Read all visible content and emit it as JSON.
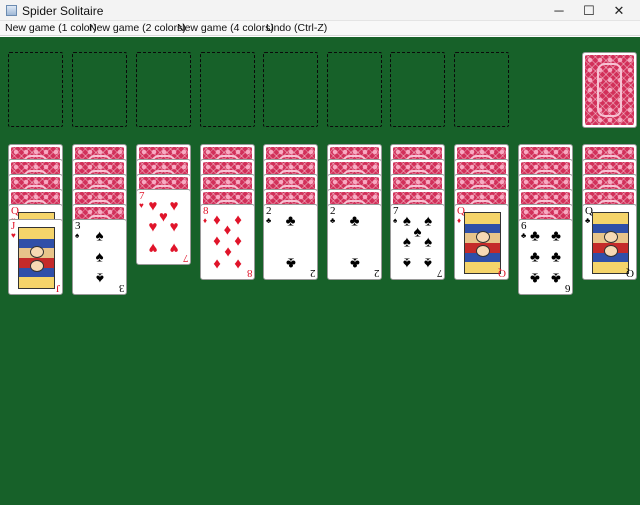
{
  "window": {
    "title": "Spider Solitaire",
    "minimize_glyph": "─",
    "maximize_glyph": "☐",
    "close_glyph": "✕"
  },
  "menu": {
    "items": [
      "New game (1 color)",
      "New game (2 colors)",
      "New game (4 colors)",
      "Undo (Ctrl-Z)"
    ]
  },
  "colors": {
    "table": "#176129",
    "back": "#d2305a",
    "red_suit": "#e0142a",
    "black_suit": "#000000"
  },
  "foundation": {
    "empty_slots": 8
  },
  "stock": {
    "face_down": true
  },
  "tableau": [
    {
      "hidden": 4,
      "face_up": [
        {
          "rank": "Q",
          "suit": "hearts"
        },
        {
          "rank": "J",
          "suit": "hearts"
        }
      ]
    },
    {
      "hidden": 5,
      "face_up": [
        {
          "rank": "3",
          "suit": "spades"
        }
      ]
    },
    {
      "hidden": 3,
      "face_up": [
        {
          "rank": "7",
          "suit": "hearts"
        }
      ]
    },
    {
      "hidden": 4,
      "face_up": [
        {
          "rank": "8",
          "suit": "diamonds"
        }
      ]
    },
    {
      "hidden": 4,
      "face_up": [
        {
          "rank": "2",
          "suit": "clubs"
        }
      ]
    },
    {
      "hidden": 4,
      "face_up": [
        {
          "rank": "2",
          "suit": "clubs"
        }
      ]
    },
    {
      "hidden": 4,
      "face_up": [
        {
          "rank": "7",
          "suit": "spades"
        }
      ]
    },
    {
      "hidden": 4,
      "face_up": [
        {
          "rank": "Q",
          "suit": "diamonds"
        }
      ]
    },
    {
      "hidden": 5,
      "face_up": [
        {
          "rank": "6",
          "suit": "clubs"
        }
      ]
    },
    {
      "hidden": 4,
      "face_up": [
        {
          "rank": "Q",
          "suit": "clubs"
        }
      ]
    }
  ]
}
